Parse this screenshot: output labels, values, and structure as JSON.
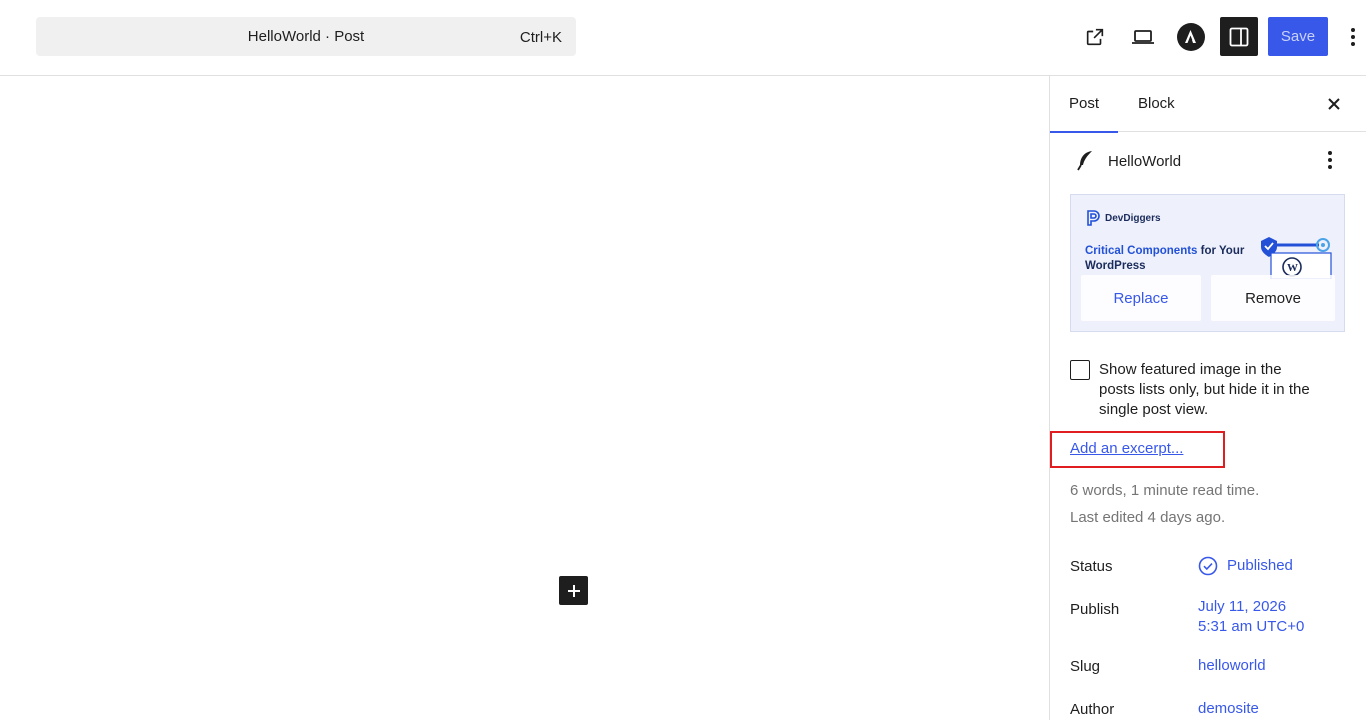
{
  "topbar": {
    "document_title": "HelloWorld · Post",
    "shortcut": "Ctrl+K",
    "save_label": "Save"
  },
  "sidebar": {
    "tabs": [
      {
        "label": "Post"
      },
      {
        "label": "Block"
      }
    ],
    "post_title": "HelloWorld",
    "featured_image": {
      "brand": "DevDiggers",
      "headline_accent": "Critical Components",
      "headline_rest": " for Your WordPress",
      "replace_label": "Replace",
      "remove_label": "Remove"
    },
    "hide_featured_label": "Show featured image in the posts lists only, but hide it in the single post view.",
    "excerpt_link": "Add an excerpt...",
    "word_count": "6 words, 1 minute read time.",
    "last_edited": "Last edited 4 days ago.",
    "status_label": "Status",
    "status_value": "Published",
    "publish_label": "Publish",
    "publish_date": "July 11, 2026",
    "publish_time": "5:31 am UTC+0",
    "slug_label": "Slug",
    "slug_value": "helloworld",
    "author_label": "Author",
    "author_value": "demosite"
  },
  "colors": {
    "accent": "#3858e9",
    "highlight_border": "#e01e22",
    "muted_text": "#757575",
    "dark": "#1e1e1e"
  },
  "icons": [
    "external-link-icon",
    "laptop-icon",
    "astra-logo-icon",
    "sidebar-toggle-icon",
    "more-vertical-icon",
    "close-icon",
    "feather-icon",
    "plus-icon",
    "check-circle-icon"
  ]
}
